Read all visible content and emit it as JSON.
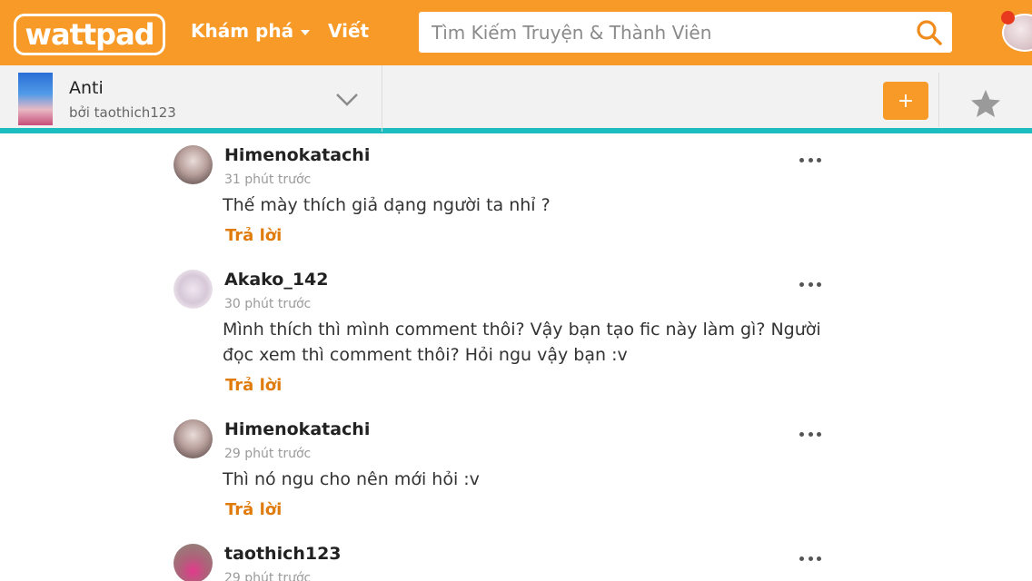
{
  "header": {
    "logo_text": "wattpad",
    "discover_label": "Khám phá",
    "write_label": "Viết",
    "search": {
      "placeholder": "Tìm Kiếm Truyện & Thành Viên",
      "value": "",
      "icon": "search-icon"
    },
    "notification_dot_color": "#e8391f",
    "brand_color": "#f79a28"
  },
  "story": {
    "title": "Anti",
    "author_line": "bởi taothich123",
    "add_button_label": "+",
    "star_icon": "star-icon",
    "accent_color": "#1cbcbf"
  },
  "comments": [
    {
      "user": "Himenokatachi",
      "time": "31 phút trước",
      "text": "Thế mày thích giả dạng người ta nhỉ ?",
      "reply_label": "Trả lời"
    },
    {
      "user": "Akako_142",
      "time": "30 phút trước",
      "text": "Mình thích thì mình comment thôi? Vậy bạn tạo fic này làm gì? Người đọc xem thì comment thôi? Hỏi ngu vậy bạn :v",
      "reply_label": "Trả lời"
    },
    {
      "user": "Himenokatachi",
      "time": "29 phút trước",
      "text": "Thì nó ngu cho nên mới hỏi :v",
      "reply_label": "Trả lời"
    },
    {
      "user": "taothich123",
      "time": "29 phút trước",
      "text": "",
      "reply_label": ""
    }
  ]
}
